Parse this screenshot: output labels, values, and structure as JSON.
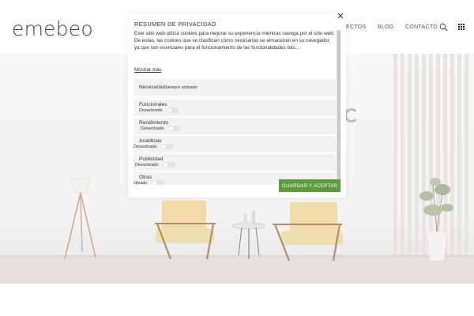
{
  "header": {
    "logo": "emebeo",
    "nav": [
      {
        "label": "ECTOS"
      },
      {
        "label": "BLOG"
      },
      {
        "label": "CONTACTO"
      }
    ]
  },
  "privacy_modal": {
    "title": "RESUMEN DE PRIVACIDAD",
    "description": "Este sitio web utiliza cookies para mejorar su experiencia mientras navega por el sitio web. De estas, las cookies que se clasifican como necesarias se almacenan en su navegador, ya que son esenciales para el funcionamiento de las funcionalidades bás...",
    "show_more": "Mostrar más",
    "categories": [
      {
        "name": "Necesarias",
        "status": "Siempre activado"
      },
      {
        "name": "Funcionales",
        "status": "Desactivado"
      },
      {
        "name": "Rendimiento",
        "status": "Desactivado"
      },
      {
        "name": "Analíticas",
        "status": "Desactivado"
      },
      {
        "name": "Publicidad",
        "status": "Desactivado"
      },
      {
        "name": "Otras",
        "status": "ctivado"
      }
    ],
    "save_button": "GUARDAR Y ACEPTAR",
    "close_symbol": "✕",
    "accent_color": "#5d9c3a"
  }
}
